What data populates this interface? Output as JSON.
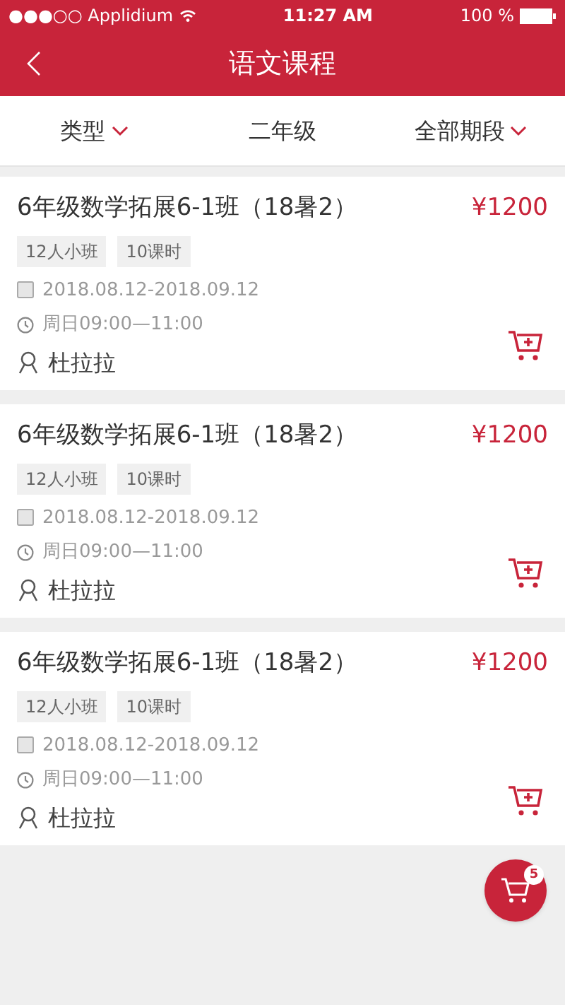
{
  "status_bar": {
    "carrier": "●●●○○ Applidium",
    "time": "11:27 AM",
    "battery": "100 %"
  },
  "header": {
    "title": "语文课程"
  },
  "filters": [
    {
      "label": "类型",
      "dropdown": true
    },
    {
      "label": "二年级",
      "dropdown": false
    },
    {
      "label": "全部期段",
      "dropdown": true
    }
  ],
  "courses": [
    {
      "title": "6年级数学拓展6-1班（18暑2）",
      "price": "¥1200",
      "tags": [
        "12人小班",
        "10课时"
      ],
      "dates": "2018.08.12-2018.09.12",
      "schedule": "周日09:00—11:00",
      "teacher": "杜拉拉"
    },
    {
      "title": "6年级数学拓展6-1班（18暑2）",
      "price": "¥1200",
      "tags": [
        "12人小班",
        "10课时"
      ],
      "dates": "2018.08.12-2018.09.12",
      "schedule": "周日09:00—11:00",
      "teacher": "杜拉拉"
    },
    {
      "title": "6年级数学拓展6-1班（18暑2）",
      "price": "¥1200",
      "tags": [
        "12人小班",
        "10课时"
      ],
      "dates": "2018.08.12-2018.09.12",
      "schedule": "周日09:00—11:00",
      "teacher": "杜拉拉"
    }
  ],
  "cart": {
    "count": "5"
  }
}
